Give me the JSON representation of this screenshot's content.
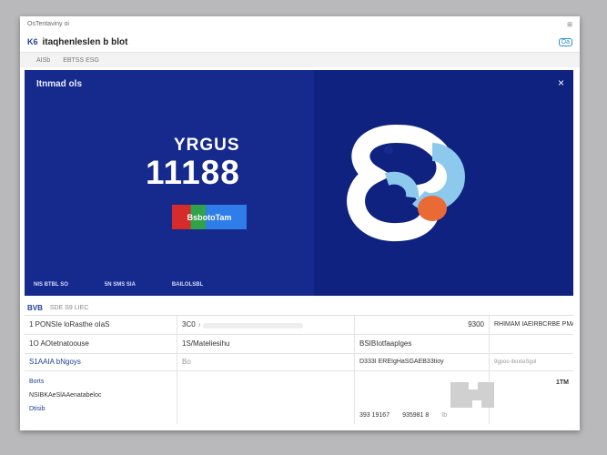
{
  "window": {
    "titlebar_text": "OsTentaviny oi",
    "titlebar_button": "⊞"
  },
  "header": {
    "logo": "K6",
    "title": "itaqhenleslen b blot",
    "chip": "Oa"
  },
  "crumbs": [
    "AISb",
    "EBTSS ESG"
  ],
  "banner": {
    "title": "Itnmad ols",
    "close_label": "×",
    "kicker": "YRGUS",
    "big_number": "11188",
    "cta_label": "BsbotoTam",
    "footer_items": [
      "NIS BTBL SO",
      "5N SMS SIA",
      "BAILOLSBL"
    ],
    "brand_colors": {
      "primary": "#16298c",
      "ring_white": "#ffffff",
      "ring_blue": "#8cc9ec",
      "accent_orange": "#ea6a36"
    }
  },
  "section": {
    "title": "BVB",
    "subtitle": "SDE S9 LIEC"
  },
  "table": {
    "head": [
      "1 PONSIe loRasthe oIaS",
      "3C0",
      "9300",
      "RHIMAM IAEIRBCRBE PMAHTHM"
    ],
    "row2": [
      "1O AOtetnatoouse",
      "1S/Mateliesihu",
      "BSIBIotfaaplges",
      ""
    ],
    "row3": [
      "S1AAIA bNgoys",
      "Bo",
      "D333I EREIgHaSGAEB33tioy",
      "9gpoo iboxtaSgol"
    ]
  },
  "tall": {
    "col1_lines": [
      "Borts",
      "NSIBKAeSlAAenatabeloc",
      "Dtisib"
    ],
    "col3_value": "393 19167",
    "col3_value2": "935981 8",
    "col3_icon_text": "Ib",
    "col4_value": "1TM"
  },
  "progress": {
    "fraction": 0.0
  }
}
